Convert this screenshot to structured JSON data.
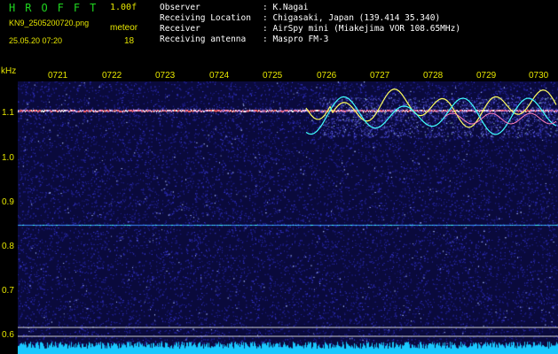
{
  "header": {
    "app_title": "HROFFT",
    "version": "1.00f",
    "filename": "KN9_2505200720.png",
    "mode": "meteor",
    "datetime": "25.05.20 07:20",
    "count": "18",
    "fields": [
      {
        "label": "Observer",
        "value": ": K.Nagai"
      },
      {
        "label": "Receiving Location",
        "value": ": Chigasaki, Japan (139.414 35.340)"
      },
      {
        "label": "Receiver",
        "value": ": AirSpy mini (Miakejima VOR 108.65MHz)"
      },
      {
        "label": "Receiving antenna",
        "value": ": Maspro FM-3"
      }
    ]
  },
  "spectrogram": {
    "unit_label": "kHz",
    "time_ticks": [
      "0721",
      "0722",
      "0723",
      "0724",
      "0725",
      "0726",
      "0727",
      "0728",
      "0729",
      "0730"
    ],
    "freq_ticks": [
      "1.1",
      "1.0",
      "0.9",
      "0.8",
      "0.7",
      "0.6"
    ],
    "colors": {
      "background": "#0a0a3c",
      "axis_text": "#e6e600",
      "header_text": "#ffffff",
      "title": "#1fd61f",
      "trace_a": "#ffff60",
      "trace_b": "#40ffff",
      "noise_floor": "#19c8ff"
    }
  }
}
